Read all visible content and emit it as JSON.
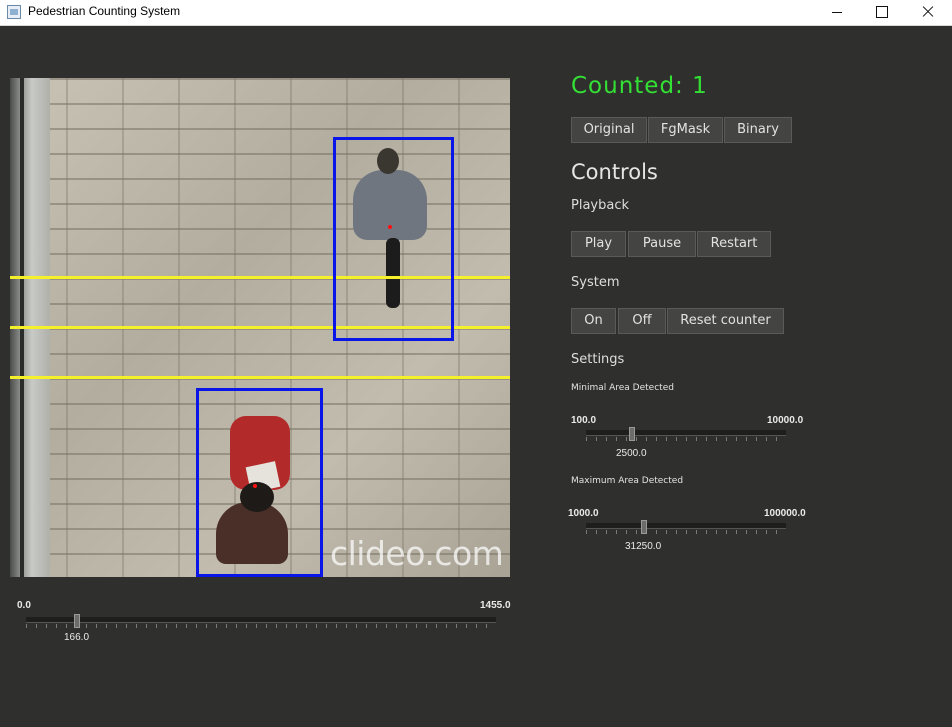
{
  "window": {
    "title": "Pedestrian Counting System"
  },
  "video": {
    "watermark": "clideo.com"
  },
  "frame_slider": {
    "min": "0.0",
    "max": "1455.0",
    "value_label": "166.0",
    "value": 166
  },
  "counter": {
    "text": "Counted: 1",
    "color": "#33e033"
  },
  "view_buttons": [
    "Original",
    "FgMask",
    "Binary"
  ],
  "controls": {
    "title": "Controls",
    "playback_label": "Playback",
    "playback_buttons": [
      "Play",
      "Pause",
      "Restart"
    ],
    "system_label": "System",
    "system_buttons": [
      "On",
      "Off",
      "Reset counter"
    ],
    "settings_label": "Settings"
  },
  "settings": {
    "min_area": {
      "label": "Minimal Area Detected",
      "min": "100.0",
      "max": "10000.0",
      "value_label": "2500.0",
      "value": 2500
    },
    "max_area": {
      "label": "Maximum Area Detected",
      "min": "1000.0",
      "max": "100000.0",
      "value_label": "31250.0",
      "value": 31250
    }
  },
  "colors": {
    "background": "#2f302e",
    "detection_box": "#0a16e8",
    "counting_line": "#f5f02a",
    "centroid": "#ff1010"
  },
  "icons": {
    "app": "window-app-icon",
    "minimize": "minimize-icon",
    "maximize": "maximize-icon",
    "close": "close-icon"
  }
}
